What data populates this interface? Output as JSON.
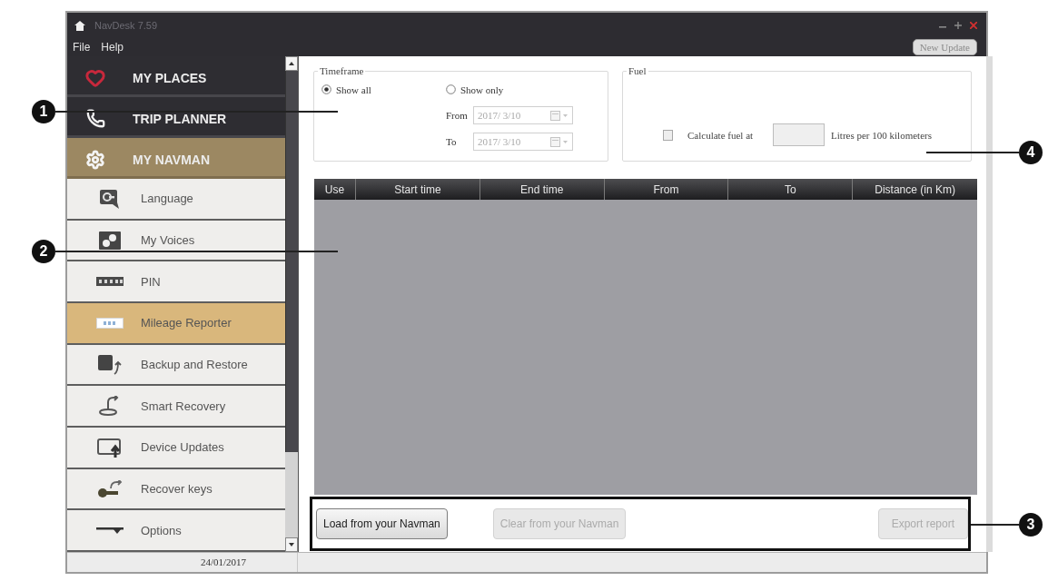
{
  "window": {
    "title": "NavDesk 7.59"
  },
  "menu": [
    {
      "label": "File"
    },
    {
      "label": "Help"
    }
  ],
  "update_button": {
    "label": "New Update"
  },
  "sidebar": {
    "sections": [
      {
        "label": "MY PLACES",
        "selected": false
      },
      {
        "label": "TRIP PLANNER",
        "selected": false
      },
      {
        "label": "MY NAVMAN",
        "selected": true
      }
    ],
    "items": [
      {
        "label": "Language",
        "selected": false
      },
      {
        "label": "My Voices",
        "selected": false
      },
      {
        "label": "PIN",
        "selected": false
      },
      {
        "label": "Mileage Reporter",
        "selected": true
      },
      {
        "label": "Backup and Restore",
        "selected": false
      },
      {
        "label": "Smart Recovery",
        "selected": false
      },
      {
        "label": "Device Updates",
        "selected": false
      },
      {
        "label": "Recover keys",
        "selected": false
      },
      {
        "label": "Options",
        "selected": false
      }
    ]
  },
  "timeframe": {
    "title": "Timeframe",
    "options": [
      {
        "label": "Show all",
        "selected": true
      },
      {
        "label": "Show only",
        "selected": false
      }
    ],
    "fields": [
      {
        "label": "From",
        "value": "2017/ 3/10",
        "disabled": true
      },
      {
        "label": "To",
        "value": "2017/ 3/10",
        "disabled": true
      }
    ]
  },
  "fuel": {
    "title": "Fuel",
    "checkbox": {
      "label": "Calculate fuel at",
      "checked": false
    },
    "amount": {
      "disabled": true
    },
    "unit": "Litres per 100 kilometers"
  },
  "table": {
    "columns": [
      "Use",
      "Start time",
      "End time",
      "From",
      "To",
      "Distance (in Km)"
    ]
  },
  "actions": [
    {
      "label": "Load from your Navman",
      "disabled": false
    },
    {
      "label": "Clear from your Navman",
      "disabled": true
    },
    {
      "label": "Export report",
      "disabled": true
    }
  ],
  "status_bar": {
    "date": "24/01/2017"
  },
  "callouts": [
    {
      "label": "1"
    },
    {
      "label": "2"
    },
    {
      "label": "3"
    },
    {
      "label": "4"
    }
  ]
}
